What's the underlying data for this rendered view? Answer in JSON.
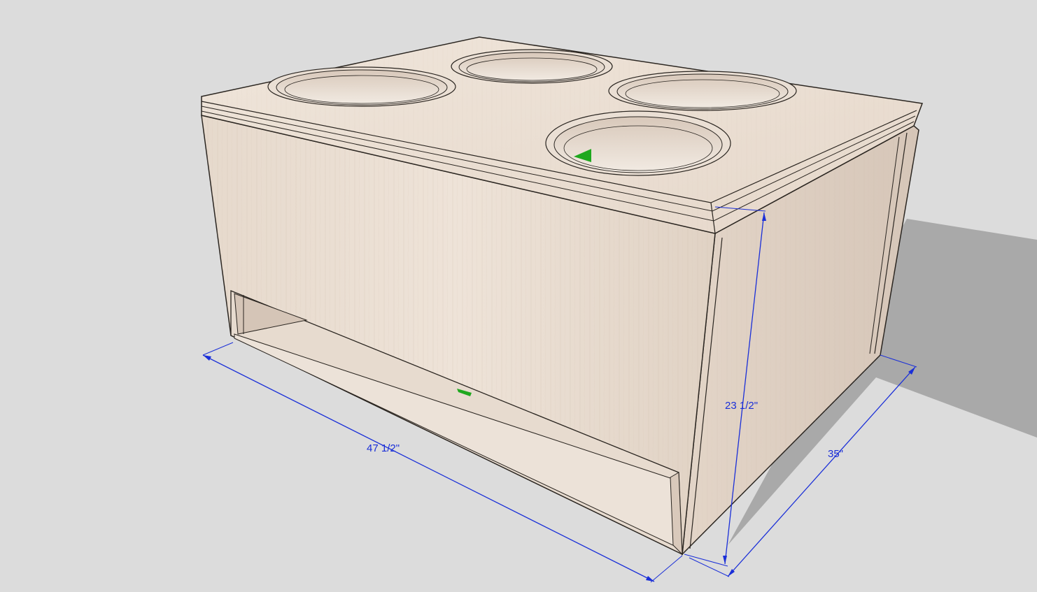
{
  "colors": {
    "background": "#dcdcdc",
    "shadow": "#a9a9a9",
    "wood_light": "#f0e6dc",
    "wood_mid": "#e2d3c6",
    "wood_dark": "#cdbcae",
    "edge": "#2a2520",
    "dimension": "#1a2fd8",
    "marker_green": "#1fa81f"
  },
  "dimensions": {
    "width": "47 1/2\"",
    "height": "23 1/2\"",
    "depth": "35\""
  },
  "icons": {
    "woofer_cutout": "circular-cutout-icon",
    "inference_marker": "green-triangle-icon"
  }
}
